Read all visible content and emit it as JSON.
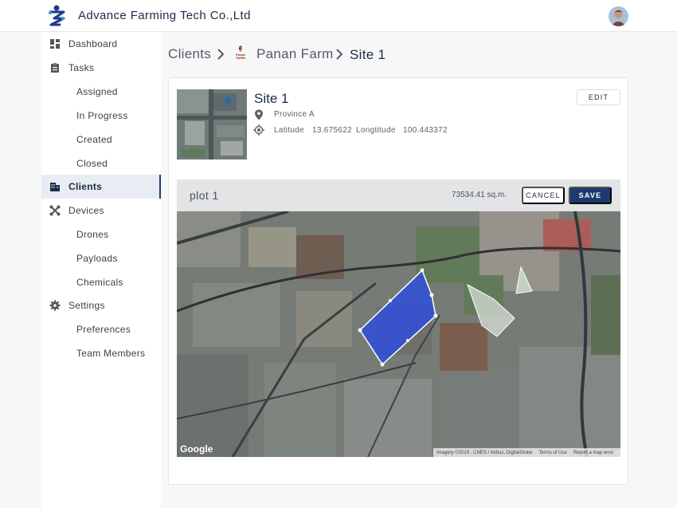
{
  "header": {
    "title": "Advance Farming Tech Co.,Ltd"
  },
  "sidebar": {
    "items": [
      {
        "label": "Dashboard",
        "icon": "dashboard-icon"
      },
      {
        "label": "Tasks",
        "icon": "clipboard-icon"
      },
      {
        "label": "Assigned",
        "sub": true
      },
      {
        "label": "In Progress",
        "sub": true
      },
      {
        "label": "Created",
        "sub": true
      },
      {
        "label": "Closed",
        "sub": true
      },
      {
        "label": "Clients",
        "icon": "building-icon",
        "active": true
      },
      {
        "label": "Devices",
        "icon": "drone-icon"
      },
      {
        "label": "Drones",
        "sub": true
      },
      {
        "label": "Payloads",
        "sub": true
      },
      {
        "label": "Chemicals",
        "sub": true
      },
      {
        "label": "Settings",
        "icon": "gear-icon"
      },
      {
        "label": "Preferences",
        "sub": true
      },
      {
        "label": "Team Members",
        "sub": true
      }
    ]
  },
  "breadcrumb": {
    "clients": "Clients",
    "farm": "Panan Farm",
    "farm_logo_text": "Panan FARM",
    "site": "Site 1"
  },
  "site": {
    "title": "Site 1",
    "province": "Province A",
    "latitude_label": "Latitude",
    "latitude": "13.675622",
    "longitude_label": "Longtitude",
    "longitude": "100.443372",
    "edit_label": "EDIT"
  },
  "map": {
    "plot_name": "plot 1",
    "area": "73534.41 sq.m.",
    "cancel_label": "CANCEL",
    "save_label": "SAVE",
    "google_label": "Google",
    "attribution": {
      "imagery": "Imagery ©2019 , CNES / Airbus, DigitalGlobe",
      "terms": "Terms of Use",
      "report": "Report a map error"
    }
  },
  "colors": {
    "primary": "#1c3a6e",
    "active_bg": "#e8ecf3",
    "plot_fill": "#2f4fd9"
  }
}
